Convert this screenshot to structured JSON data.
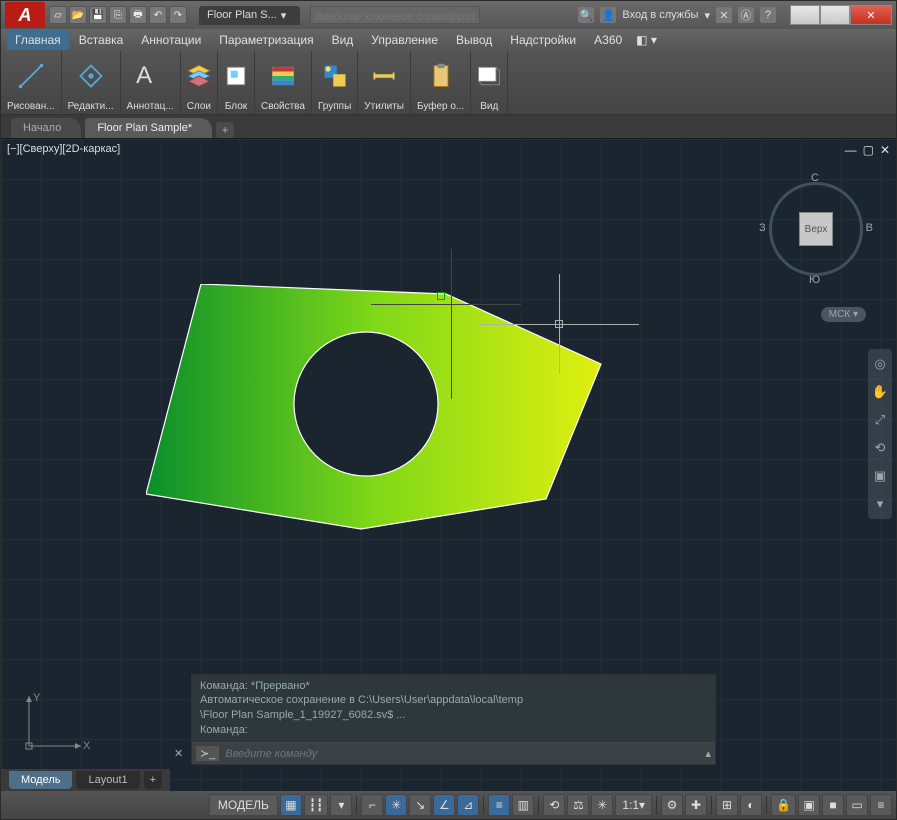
{
  "titlebar": {
    "app": "A",
    "tab_title": "Floor Plan S...",
    "search_placeholder": "Введите ключевое слово/фразу",
    "signin": "Вход в службы",
    "help": "?"
  },
  "menubar": {
    "items": [
      {
        "label": "Главная",
        "active": true
      },
      {
        "label": "Вставка",
        "active": false
      },
      {
        "label": "Аннотации",
        "active": false
      },
      {
        "label": "Параметризация",
        "active": false
      },
      {
        "label": "Вид",
        "active": false
      },
      {
        "label": "Управление",
        "active": false
      },
      {
        "label": "Вывод",
        "active": false
      },
      {
        "label": "Надстройки",
        "active": false
      },
      {
        "label": "A360",
        "active": false
      }
    ]
  },
  "ribbon": {
    "panels": [
      {
        "label": "Рисован..."
      },
      {
        "label": "Редакти..."
      },
      {
        "label": "Аннотац..."
      },
      {
        "label": "Слои"
      },
      {
        "label": "Блок"
      },
      {
        "label": "Свойства"
      },
      {
        "label": "Группы"
      },
      {
        "label": "Утилиты"
      },
      {
        "label": "Буфер о..."
      },
      {
        "label": "Вид"
      }
    ]
  },
  "doctabs": {
    "start": "Начало",
    "active": "Floor Plan Sample*",
    "add": "+"
  },
  "viewport": {
    "label": "[−][Сверху][2D-каркас]",
    "viewcube": {
      "top": "Верх",
      "n": "С",
      "s": "Ю",
      "e": "В",
      "w": "З"
    },
    "ucs": "МСК",
    "axis_x": "X",
    "axis_y": "Y"
  },
  "command": {
    "line1": "Команда: *Прервано*",
    "line2": "Автоматическое сохранение в C:\\Users\\User\\appdata\\local\\temp",
    "line3": "\\Floor Plan Sample_1_19927_6082.sv$ ...",
    "line4": "Команда:",
    "placeholder": "Введите команду"
  },
  "layout_tabs": {
    "model": "Модель",
    "layout1": "Layout1",
    "add": "+"
  },
  "statusbar": {
    "model_btn": "МОДЕЛЬ",
    "scale": "1:1"
  }
}
